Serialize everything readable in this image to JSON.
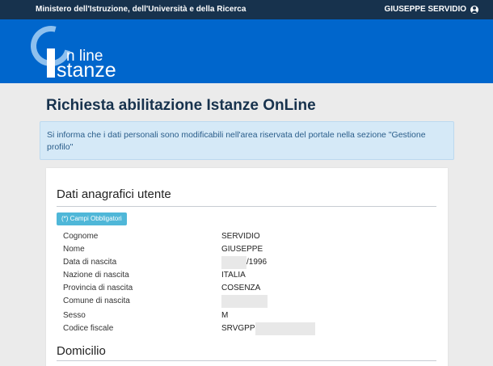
{
  "topbar": {
    "ministry": "Ministero dell'Istruzione, dell'Università e della Ricerca",
    "user": "GIUSEPPE SERVIDIO",
    "user_icon": "user-circle-icon"
  },
  "logo": {
    "line1": "n line",
    "line2": "stanze"
  },
  "page": {
    "title": "Richiesta abilitazione Istanze OnLine"
  },
  "alert": {
    "text": "Si informa che i dati personali sono modificabili nell'area riservata del portale nella sezione \"Gestione profilo\""
  },
  "section1": {
    "title": "Dati anagrafici utente",
    "badge": "(*) Campi Obbligatori",
    "fields": {
      "cognome": {
        "label": "Cognome",
        "value": "SERVIDIO"
      },
      "nome": {
        "label": "Nome",
        "value": "GIUSEPPE"
      },
      "data_nascita": {
        "label": "Data di nascita",
        "value": "/1996"
      },
      "nazione": {
        "label": "Nazione di nascita",
        "value": "ITALIA"
      },
      "provincia": {
        "label": "Provincia di nascita",
        "value": "COSENZA"
      },
      "comune": {
        "label": "Comune di nascita",
        "value": ""
      },
      "sesso": {
        "label": "Sesso",
        "value": "M"
      },
      "codice_fiscale": {
        "label": "Codice fiscale",
        "value": "SRVGPP"
      }
    }
  },
  "section2": {
    "title": "Domicilio"
  },
  "colors": {
    "topbar": "#17324d",
    "header": "#0066cc",
    "badge": "#4fb7d8",
    "alert_bg": "#d5e9f7"
  }
}
